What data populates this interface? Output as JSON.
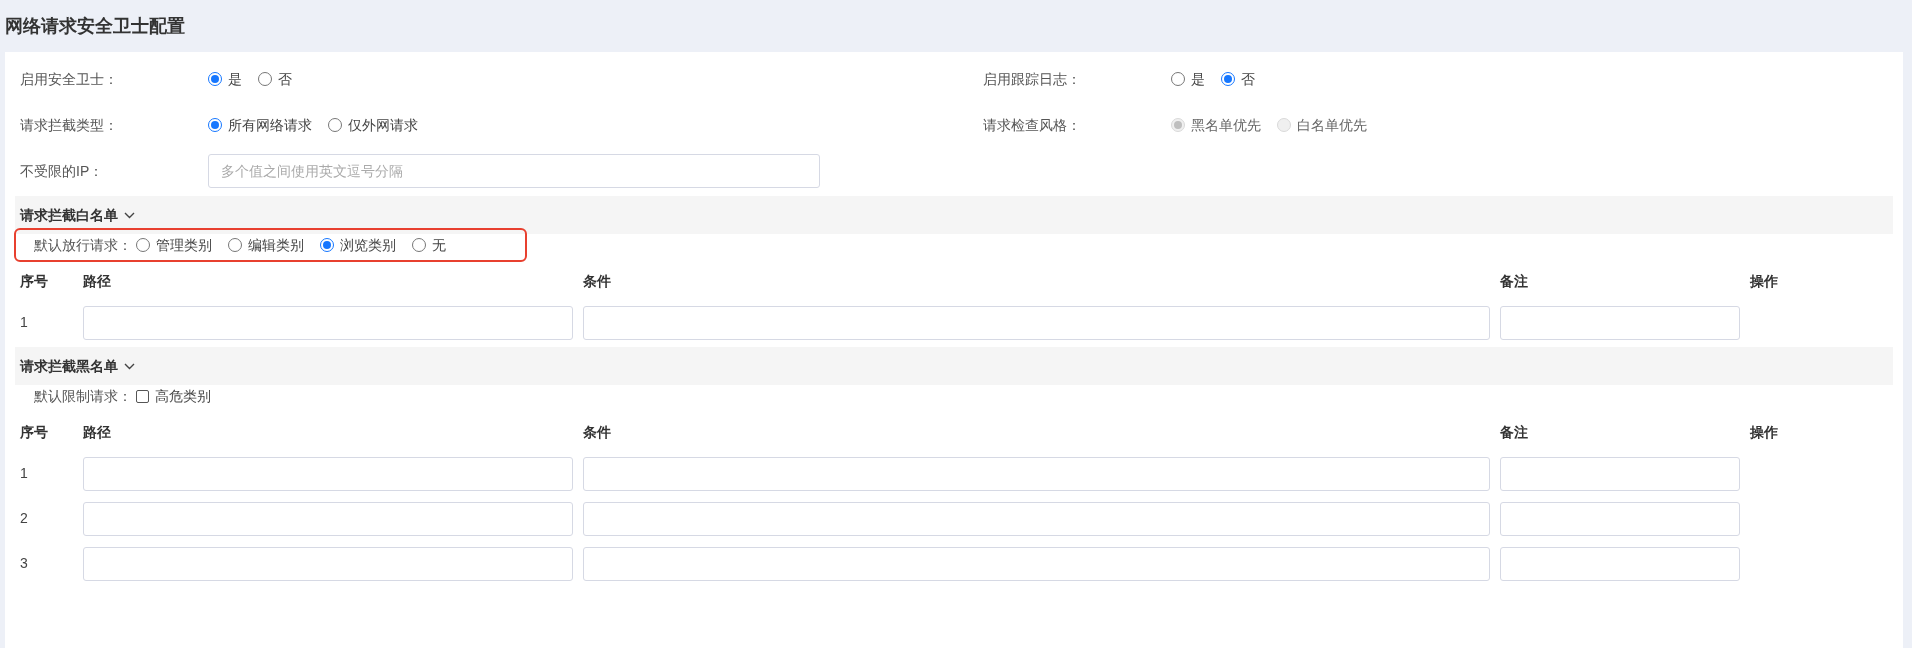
{
  "page_title": "网络请求安全卫士配置",
  "settings": [
    {
      "fields": [
        {
          "kind": "radio",
          "label": "启用安全卫士：",
          "disabled": false,
          "options": [
            {
              "label": "是",
              "selected": true
            },
            {
              "label": "否",
              "selected": false
            }
          ]
        },
        {
          "kind": "radio",
          "label": "启用跟踪日志：",
          "disabled": false,
          "options": [
            {
              "label": "是",
              "selected": false
            },
            {
              "label": "否",
              "selected": true
            }
          ]
        }
      ]
    },
    {
      "fields": [
        {
          "kind": "radio",
          "label": "请求拦截类型：",
          "disabled": false,
          "options": [
            {
              "label": "所有网络请求",
              "selected": true
            },
            {
              "label": "仅外网请求",
              "selected": false
            }
          ]
        },
        {
          "kind": "radio",
          "label": "请求检查风格：",
          "disabled": true,
          "options": [
            {
              "label": "黑名单优先",
              "selected": true
            },
            {
              "label": "白名单优先",
              "selected": false
            }
          ]
        }
      ]
    },
    {
      "fields": [
        {
          "kind": "input",
          "label": "不受限的IP：",
          "placeholder": "多个值之间使用英文逗号分隔"
        }
      ]
    }
  ],
  "sections": [
    {
      "title": "请求拦截白名单",
      "expanded": true,
      "default_row": {
        "kind": "radio",
        "label": "默认放行请求：",
        "highlighted": true,
        "options": [
          {
            "label": "管理类别",
            "selected": false
          },
          {
            "label": "编辑类别",
            "selected": false
          },
          {
            "label": "浏览类别",
            "selected": true
          },
          {
            "label": "无",
            "selected": false
          }
        ]
      },
      "columns": [
        "序号",
        "路径",
        "条件",
        "备注",
        "操作"
      ],
      "rows": [
        {
          "index": "1"
        }
      ]
    },
    {
      "title": "请求拦截黑名单",
      "expanded": true,
      "default_row": {
        "kind": "checkbox",
        "label": "默认限制请求：",
        "highlighted": false,
        "options": [
          {
            "label": "高危类别",
            "checked": false
          }
        ]
      },
      "columns": [
        "序号",
        "路径",
        "条件",
        "备注",
        "操作"
      ],
      "rows": [
        {
          "index": "1"
        },
        {
          "index": "2"
        },
        {
          "index": "3"
        }
      ]
    }
  ]
}
